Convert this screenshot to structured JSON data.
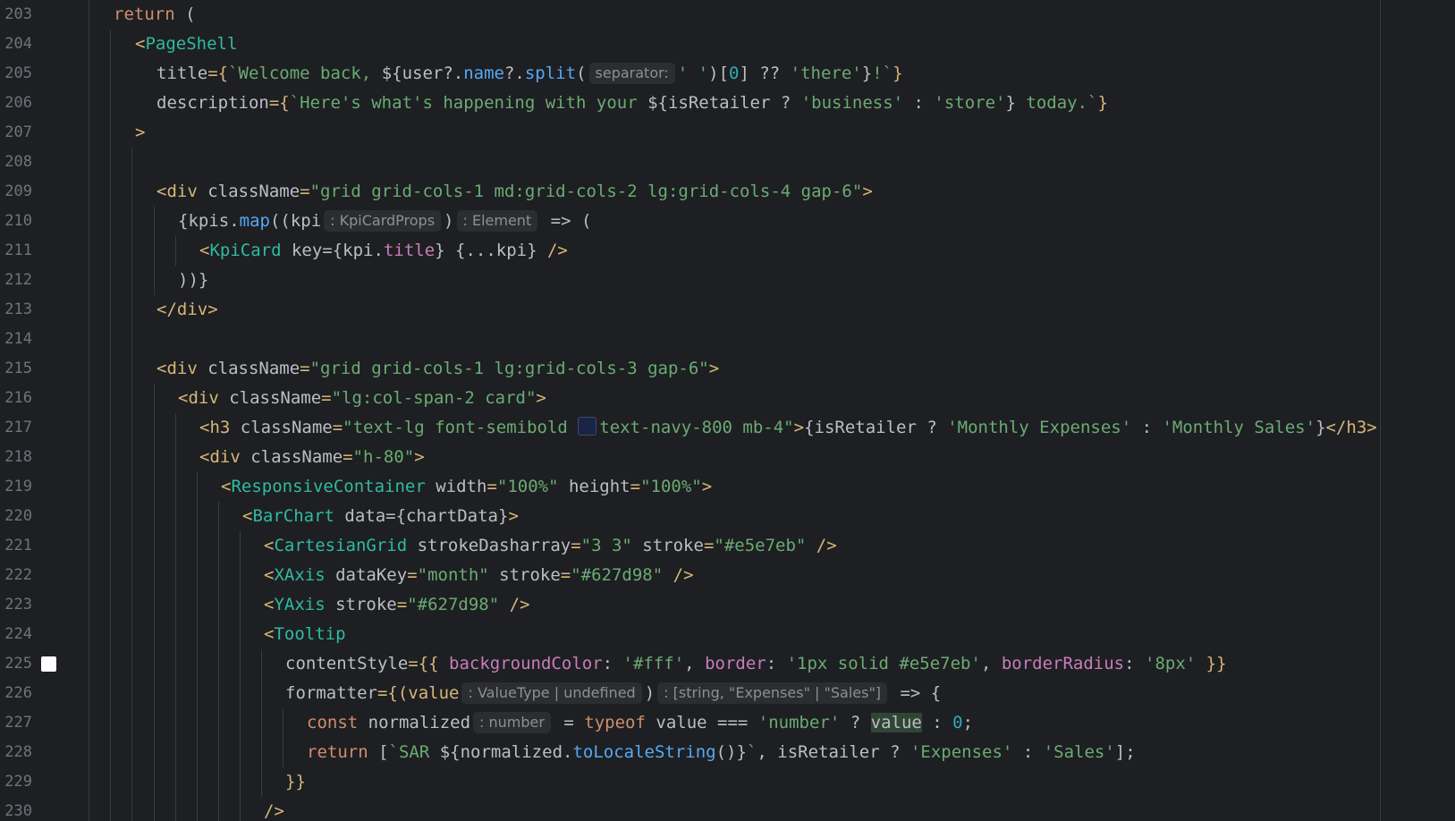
{
  "editor": {
    "colors": {
      "background": "#1e1f22",
      "keyword": "#cf8e6d",
      "string": "#6aab73",
      "tag": "#d5b778",
      "component": "#2fbaa3"
    },
    "lines": [
      {
        "n": "203",
        "indent": 1,
        "t": {
          "a": "return",
          "b": " ("
        }
      },
      {
        "n": "204",
        "indent": 2,
        "t": {
          "a": "<",
          "b": "PageShell"
        }
      },
      {
        "n": "205",
        "indent": 3,
        "t": {
          "a": "title",
          "b": "={",
          "c": "`Welcome back, ",
          "d": "${user?.",
          "e": "name",
          "f": "?.",
          "g": "split",
          "h": "(",
          "hint": "separator:",
          "i": "' '",
          "j": ")[",
          "k": "0",
          "l": "] ?? ",
          "m": "'there'",
          "o": "}",
          "p": "!`",
          "q": "}"
        }
      },
      {
        "n": "206",
        "indent": 3,
        "t": {
          "a": "description",
          "b": "={",
          "c": "`Here's what's happening with your ",
          "d": "${isRetailer ? ",
          "e": "'business'",
          "f": " : ",
          "g": "'store'",
          "h": "}",
          "i": " today.`",
          "j": "}"
        }
      },
      {
        "n": "207",
        "indent": 2,
        "t": {
          "a": ">"
        }
      },
      {
        "n": "208",
        "indent": 0,
        "t": {}
      },
      {
        "n": "209",
        "indent": 3,
        "t": {
          "a": "<div",
          "b": " className",
          "c": "=",
          "d": "\"grid grid-cols-1 md:grid-cols-2 lg:grid-cols-4 gap-6\"",
          "e": ">"
        }
      },
      {
        "n": "210",
        "indent": 4,
        "t": {
          "a": "{kpis.",
          "b": "map",
          "c": "((kpi",
          "hint1": ": KpiCardProps",
          "d": ")",
          "hint2": ": Element",
          "e": " => ("
        }
      },
      {
        "n": "211",
        "indent": 5,
        "t": {
          "a": "<",
          "b": "KpiCard",
          "c": " key",
          "d": "={kpi.",
          "e": "title",
          "f": "} {...kpi} ",
          "g": "/>"
        }
      },
      {
        "n": "212",
        "indent": 4,
        "t": {
          "a": "))}"
        }
      },
      {
        "n": "213",
        "indent": 3,
        "t": {
          "a": "</div>"
        }
      },
      {
        "n": "214",
        "indent": 0,
        "t": {}
      },
      {
        "n": "215",
        "indent": 3,
        "t": {
          "a": "<div",
          "b": " className",
          "c": "=",
          "d": "\"grid grid-cols-1 lg:grid-cols-3 gap-6\"",
          "e": ">"
        }
      },
      {
        "n": "216",
        "indent": 4,
        "t": {
          "a": "<div",
          "b": " className",
          "c": "=",
          "d": "\"lg:col-span-2 card\"",
          "e": ">"
        }
      },
      {
        "n": "217",
        "indent": 5,
        "t": {
          "a": "<h3",
          "b": " className",
          "c": "=",
          "d": "\"text-lg font-semibold ",
          "e": "text-navy-800 mb-4\"",
          "f": ">",
          "g": "{isRetailer ? ",
          "h": "'Monthly Expenses'",
          "i": " : ",
          "j": "'Monthly Sales'",
          "k": "}",
          "l": "</h3>"
        }
      },
      {
        "n": "218",
        "indent": 5,
        "t": {
          "a": "<div",
          "b": " className",
          "c": "=",
          "d": "\"h-80\"",
          "e": ">"
        }
      },
      {
        "n": "219",
        "indent": 6,
        "t": {
          "a": "<",
          "b": "ResponsiveContainer",
          "c": " width",
          "d": "=",
          "e": "\"100%\"",
          "f": " height",
          "g": "=",
          "h": "\"100%\"",
          "i": ">"
        }
      },
      {
        "n": "220",
        "indent": 7,
        "t": {
          "a": "<",
          "b": "BarChart",
          "c": " data",
          "d": "={chartData}",
          "e": ">"
        }
      },
      {
        "n": "221",
        "indent": 8,
        "t": {
          "a": "<",
          "b": "CartesianGrid",
          "c": " strokeDasharray",
          "d": "=",
          "e": "\"3 3\"",
          "f": " stroke",
          "g": "=",
          "h": "\"#e5e7eb\"",
          "i": " />"
        }
      },
      {
        "n": "222",
        "indent": 8,
        "t": {
          "a": "<",
          "b": "XAxis",
          "c": " dataKey",
          "d": "=",
          "e": "\"month\"",
          "f": " stroke",
          "g": "=",
          "h": "\"#627d98\"",
          "i": " />"
        }
      },
      {
        "n": "223",
        "indent": 8,
        "t": {
          "a": "<",
          "b": "YAxis",
          "c": " stroke",
          "d": "=",
          "e": "\"#627d98\"",
          "f": " />"
        }
      },
      {
        "n": "224",
        "indent": 8,
        "t": {
          "a": "<",
          "b": "Tooltip"
        }
      },
      {
        "n": "225",
        "indent": 9,
        "t": {
          "a": "contentStyle",
          "b": "={{ ",
          "c": "backgroundColor",
          "d": ": ",
          "e": "'#fff'",
          "f": ", ",
          "g": "border",
          "h": ": ",
          "i": "'1px solid #e5e7eb'",
          "j": ", ",
          "k": "borderRadius",
          "l": ": ",
          "m": "'8px'",
          "o": " }}"
        }
      },
      {
        "n": "226",
        "indent": 9,
        "t": {
          "a": "formatter",
          "b": "={(value",
          "hint1": ": ValueType | undefined",
          "c": ")",
          "hint2": ": [string, \"Expenses\" | \"Sales\"]",
          "d": " => {"
        }
      },
      {
        "n": "227",
        "indent": 10,
        "t": {
          "a": "const",
          "b": " normalized",
          "hint": ": number",
          "c": " = ",
          "d": "typeof",
          "e": " value === ",
          "f": "'number'",
          "g": " ? ",
          "h": "value",
          "i": " : ",
          "j": "0",
          "k": ";"
        }
      },
      {
        "n": "228",
        "indent": 10,
        "t": {
          "a": "return",
          "b": " [",
          "c": "`SAR ",
          "d": "${normalized.",
          "e": "toLocaleString",
          "f": "()}",
          "g": "`",
          "h": ", isRetailer ? ",
          "i": "'Expenses'",
          "j": " : ",
          "k": "'Sales'",
          "l": "];"
        }
      },
      {
        "n": "229",
        "indent": 9,
        "t": {
          "a": "}}"
        }
      },
      {
        "n": "230",
        "indent": 8,
        "t": {
          "a": "/>"
        }
      }
    ]
  }
}
